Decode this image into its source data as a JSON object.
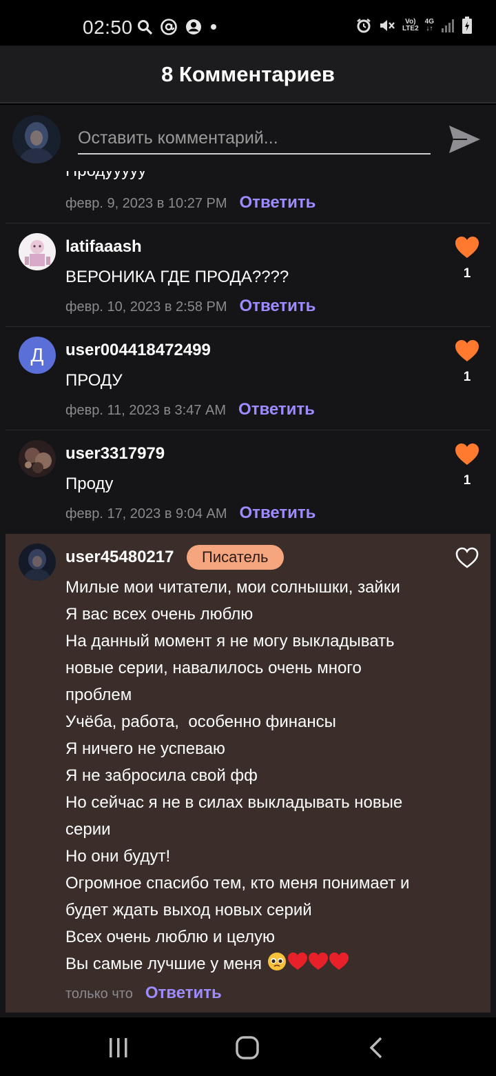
{
  "status_bar": {
    "time": "02:50",
    "left_icons": [
      "search-icon",
      "at-icon",
      "account-circle-icon",
      "dot-icon"
    ],
    "right_icons": [
      "alarm-icon",
      "mute-icon",
      "volte-icon",
      "network-4g-icon",
      "signal-icon",
      "battery-icon"
    ],
    "volte_top": "Vo)",
    "volte_bottom": "LTE2",
    "network": "4G"
  },
  "header": {
    "title": "8 Комментариев"
  },
  "input": {
    "placeholder": "Оставить комментарий..."
  },
  "colors": {
    "accent": "#9d8cff",
    "like": "#ff7a2f",
    "badge": "#f6a67e",
    "writer_bg": "#3a2d2a"
  },
  "comments": [
    {
      "text_partial": "Продууууу",
      "date": "февр. 9, 2023 в 10:27 PM",
      "reply": "Ответить"
    },
    {
      "username": "latifaaash",
      "text": "ВЕРОНИКА ГДЕ ПРОДА????",
      "date": "февр. 10, 2023 в 2:58 PM",
      "reply": "Ответить",
      "likes": "1"
    },
    {
      "username": "user004418472499",
      "avatar_letter": "Д",
      "text": "ПРОДУ",
      "date": "февр. 11, 2023 в 3:47 AM",
      "reply": "Ответить",
      "likes": "1"
    },
    {
      "username": "user3317979",
      "text": "Проду",
      "date": "февр. 17, 2023 в 9:04 AM",
      "reply": "Ответить",
      "likes": "1"
    },
    {
      "username": "user45480217",
      "badge": "Писатель",
      "lines": [
        "Милые мои читатели, мои солнышки, зайки",
        "Я вас всех очень люблю",
        "На данный момент я не могу выкладывать",
        "новые серии, навалилось очень много",
        "проблем",
        "Учёба, работа,  особенно финансы",
        "Я ничего не успеваю",
        "Я не забросила свой фф",
        "Но сейчас я не в силах выкладывать новые",
        "серии",
        "Но они будут!",
        "Огромное спасибо тем, кто меня понимает и",
        "будет ждать выход новых серий",
        "Всех очень люблю и целую",
        "Вы самые лучшие у меня"
      ],
      "emojis": [
        "pleading-face-emoji",
        "red-heart-emoji",
        "red-heart-emoji",
        "red-heart-emoji"
      ],
      "date": "только что",
      "reply": "Ответить"
    }
  ],
  "nav": {
    "icons": [
      "recent-apps-icon",
      "home-icon",
      "back-icon"
    ]
  }
}
